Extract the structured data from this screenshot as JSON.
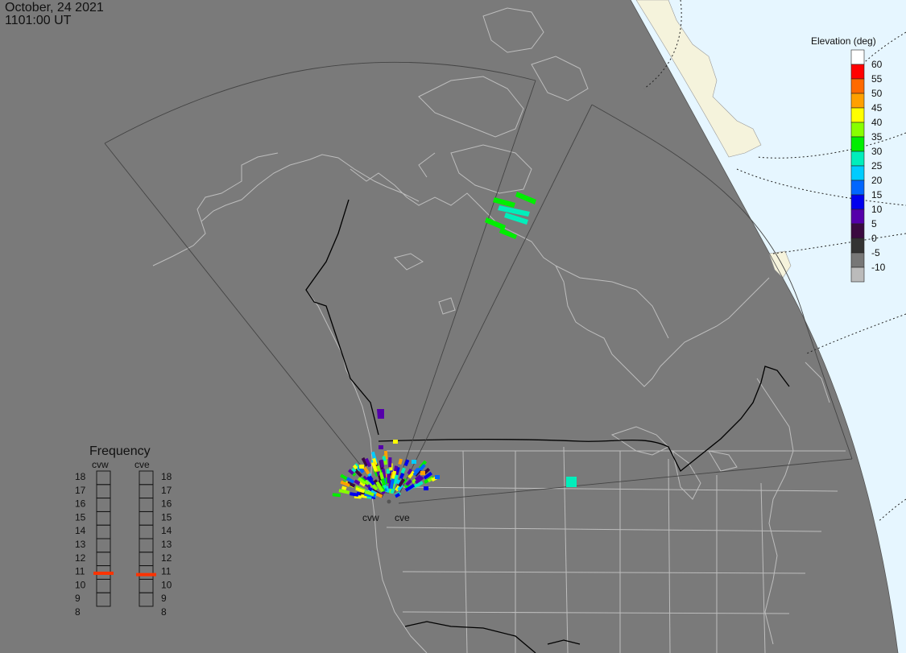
{
  "header": {
    "date": "October, 24 2021",
    "time": "1101:00 UT"
  },
  "radars": {
    "west": "cvw",
    "east": "cve"
  },
  "elevation_scale": {
    "title": "Elevation (deg)",
    "bins": [
      {
        "label": "60",
        "color": "#ffffff"
      },
      {
        "label": "55",
        "color": "#ff0000"
      },
      {
        "label": "50",
        "color": "#ff6a00"
      },
      {
        "label": "45",
        "color": "#ffa000"
      },
      {
        "label": "40",
        "color": "#ffff00"
      },
      {
        "label": "35",
        "color": "#88ff00"
      },
      {
        "label": "30",
        "color": "#00ee00"
      },
      {
        "label": "25",
        "color": "#00eebb"
      },
      {
        "label": "20",
        "color": "#00ccff"
      },
      {
        "label": "15",
        "color": "#0066ff"
      },
      {
        "label": "10",
        "color": "#0000ee"
      },
      {
        "label": "5",
        "color": "#5500aa"
      },
      {
        "label": "0",
        "color": "#3a0a40"
      },
      {
        "label": "-5",
        "color": "#333333"
      },
      {
        "label": "-10",
        "color": "#777777"
      },
      {
        "label": "",
        "color": "#bbbbbb"
      }
    ]
  },
  "frequency_panel": {
    "title": "Frequency",
    "columns": [
      "cvw",
      "cve"
    ],
    "levels": [
      "18",
      "17",
      "16",
      "15",
      "14",
      "13",
      "12",
      "11",
      "10",
      "9",
      "8"
    ],
    "selected": {
      "cvw": 10.8,
      "cve": 10.7
    },
    "marker_color": "#ff3300"
  },
  "map_colors": {
    "night": "#7a7a7a",
    "day_ocean": "#e6f6ff",
    "day_land": "#f5f3dc",
    "coast": "#bdbdbd",
    "border": "#000000",
    "fov": "#444444"
  }
}
